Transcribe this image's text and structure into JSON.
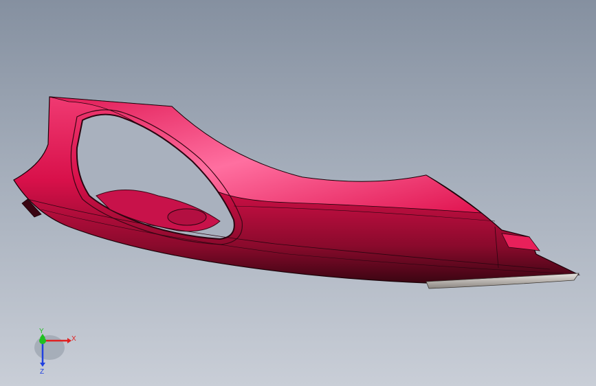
{
  "viewport": {
    "background_top": "#8590a0",
    "background_bottom": "#c9ced7"
  },
  "model": {
    "name": "bumper-part",
    "color": "#e0134f",
    "shadow_color": "#4a0717"
  },
  "triad": {
    "x_label": "X",
    "y_label": "Y",
    "z_label": "Z",
    "x_color": "#e02020",
    "y_color": "#20c020",
    "z_color": "#2040e0"
  }
}
